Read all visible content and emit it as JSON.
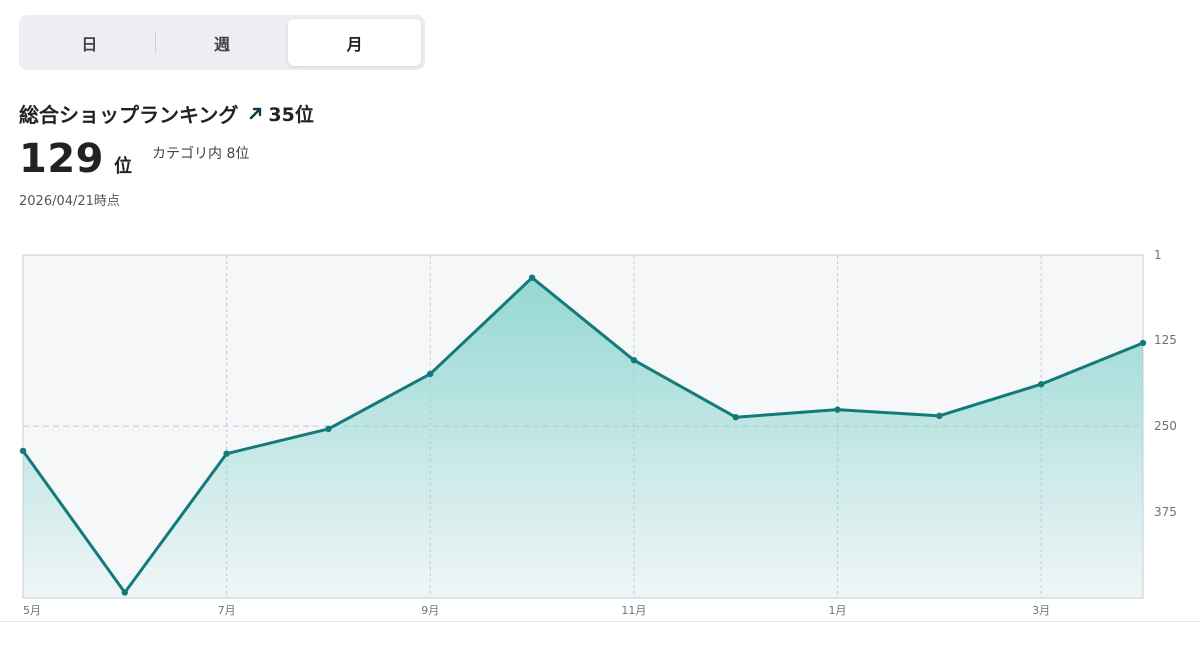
{
  "tabs": [
    {
      "label": "日",
      "active": false
    },
    {
      "label": "週",
      "active": false
    },
    {
      "label": "月",
      "active": true
    }
  ],
  "ranking": {
    "title": "総合ショップランキング",
    "change_label": "35位",
    "rank_value": "129",
    "rank_unit": "位",
    "category_rank": "カテゴリ内 8位",
    "as_of": "2026/04/21時点"
  },
  "colors": {
    "line": "#137a7a",
    "fill_top": "#8fd6d0",
    "plot_bg": "#f5f7f9",
    "change_arrow": "#0f3a47"
  },
  "chart_data": {
    "type": "area",
    "y_axis_inverted": true,
    "ylim": [
      1,
      500
    ],
    "y_ticks": [
      1,
      125,
      250,
      375
    ],
    "x": [
      "5月",
      "6月",
      "7月",
      "8月",
      "9月",
      "10月",
      "11月",
      "12月",
      "1月",
      "2月",
      "3月",
      "4月"
    ],
    "x_tick_labels": [
      "5月",
      "7月",
      "9月",
      "11月",
      "1月",
      "3月"
    ],
    "values": [
      286,
      492,
      290,
      254,
      174,
      34,
      154,
      237,
      226,
      235,
      189,
      129
    ],
    "grid": true,
    "reference_line": 250
  }
}
